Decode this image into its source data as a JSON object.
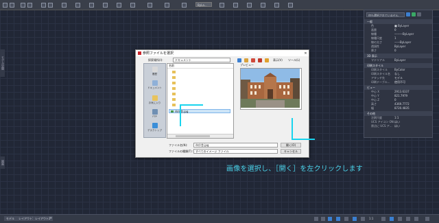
{
  "ribbon": {
    "input_value": "ByLa..."
  },
  "side_tags": {
    "top": "モデル空間",
    "mid": "図面"
  },
  "properties": {
    "selection": "何も選択されていません",
    "sections": [
      {
        "title": "一般",
        "rows": [
          {
            "k": "色",
            "v": "■ ByLayer"
          },
          {
            "k": "画層",
            "v": "0"
          },
          {
            "k": "線種",
            "v": "———ByLayer"
          },
          {
            "k": "線種尺度",
            "v": "1"
          },
          {
            "k": "線の太さ",
            "v": "——ByLayer"
          },
          {
            "k": "透過性",
            "v": "ByLayer"
          },
          {
            "k": "厚さ",
            "v": "0"
          }
        ]
      },
      {
        "title": "3D 表示",
        "rows": [
          {
            "k": "マテリアル",
            "v": "ByLayer"
          }
        ]
      },
      {
        "title": "印刷スタイル",
        "rows": [
          {
            "k": "印刷スタイル",
            "v": "ByColor"
          },
          {
            "k": "印刷スタイル名",
            "v": "なし"
          },
          {
            "k": "アタッチ先",
            "v": "モデル"
          },
          {
            "k": "印刷テーブル...",
            "v": "使用不可"
          }
        ]
      },
      {
        "title": "ビュー",
        "rows": [
          {
            "k": "中心 X",
            "v": "2913.6337"
          },
          {
            "k": "中心 Y",
            "v": "821.7979"
          },
          {
            "k": "中心 Z",
            "v": "0"
          },
          {
            "k": "高さ",
            "v": "4369.7772"
          },
          {
            "k": "幅",
            "v": "8720.4835"
          }
        ]
      },
      {
        "title": "その他",
        "rows": [
          {
            "k": "注釈尺度",
            "v": "1:1"
          },
          {
            "k": "UCS アイコン ON",
            "v": "はい"
          },
          {
            "k": "原点に UCS ア...",
            "v": "はい"
          }
        ]
      }
    ]
  },
  "dialog": {
    "title": "参照ファイルを選択",
    "close": "✕",
    "lookin_label": "探索場所(I):",
    "lookin_value": "ドキュメント",
    "preview_label": "プレビュー",
    "view_label": "表示(V)",
    "tools_label": "ツール(L)",
    "places": [
      {
        "label": "履歴",
        "color": "#d9d9d9"
      },
      {
        "label": "ドキュメント",
        "color": "#8fb0d8"
      },
      {
        "label": "お気に入り",
        "color": "#e8c35e"
      },
      {
        "label": "FTP",
        "color": "#6f8fb3"
      },
      {
        "label": "デスクトップ",
        "color": "#3b8ed8"
      }
    ],
    "list_header": "名前",
    "selected_file": "市庁舎.jpg",
    "filename_label": "ファイル名(N):",
    "filename_value": "市庁舎.jpg",
    "filetype_label": "ファイルの種類(T):",
    "filetype_value": "すべてのイメージ ファイル",
    "open_label": "開く(O)",
    "cancel_label": "キャンセル"
  },
  "caption": "画像を選択し、［開く］を左クリックします",
  "status": {
    "tabs": [
      "モデル",
      "レイアウト1",
      "レイアウト2"
    ],
    "scale": "1:1"
  },
  "colors": {
    "accent": "#18d4ee",
    "caption": "#4bd3ea"
  }
}
